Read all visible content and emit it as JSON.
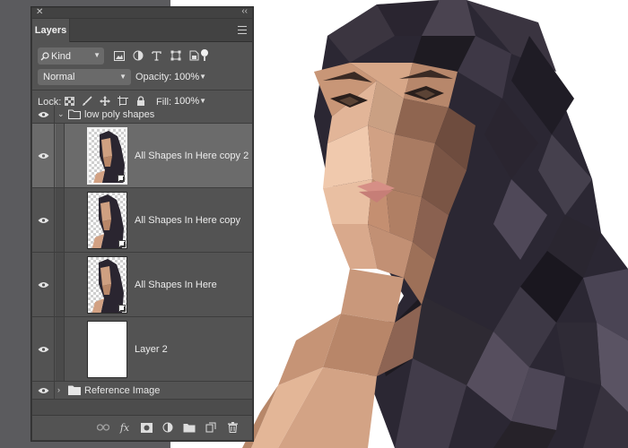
{
  "panel": {
    "tab_label": "Layers",
    "filter_kind": "Kind",
    "blend_mode": "Normal",
    "opacity_label": "Opacity:",
    "opacity_value": "100%",
    "lock_label": "Lock:",
    "fill_label": "Fill:",
    "fill_value": "100%"
  },
  "layers": {
    "group1": {
      "name": "low poly shapes",
      "expanded": true
    },
    "item1": {
      "name": "All Shapes In Here copy 2",
      "selected": true
    },
    "item2": {
      "name": "All Shapes In Here copy"
    },
    "item3": {
      "name": "All Shapes In Here"
    },
    "item4": {
      "name": "Layer 2"
    },
    "group2": {
      "name": "Reference Image",
      "expanded": false
    }
  },
  "footer": {
    "fx_label": "fx"
  },
  "icons": {
    "filter": [
      "pixel-filter-icon",
      "adjustment-filter-icon",
      "type-filter-icon",
      "shape-filter-icon",
      "smart-object-filter-icon"
    ],
    "lock": [
      "lock-transparent-icon",
      "lock-brush-icon",
      "lock-position-icon",
      "lock-artboard-icon",
      "lock-all-icon"
    ],
    "footer": [
      "link-layers-icon",
      "fx-icon",
      "add-mask-icon",
      "adjustment-layer-icon",
      "new-group-icon",
      "new-layer-icon",
      "trash-icon"
    ]
  },
  "colors": {
    "panel_bg": "#535353",
    "selected_row": "#6b6b6b",
    "workspace": "#5b5b5e"
  }
}
